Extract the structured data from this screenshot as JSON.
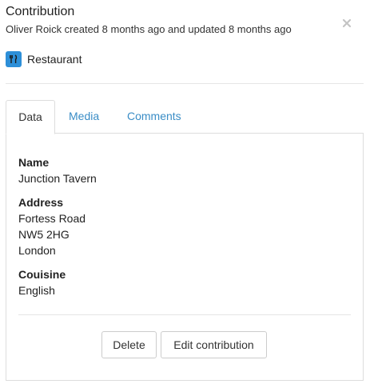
{
  "header": {
    "title": "Contribution",
    "meta": "Oliver Roick created 8 months ago and updated 8 months ago",
    "close_icon": "close-icon"
  },
  "category": {
    "icon": "restaurant-cutlery-icon",
    "icon_color": "#2d8fd8",
    "label": "Restaurant"
  },
  "tabs": [
    {
      "label": "Data",
      "active": true
    },
    {
      "label": "Media",
      "active": false
    },
    {
      "label": "Comments",
      "active": false
    }
  ],
  "fields": {
    "name": {
      "label": "Name",
      "values": [
        "Junction Tavern"
      ]
    },
    "address": {
      "label": "Address",
      "values": [
        "Fortess Road",
        "NW5 2HG",
        "London"
      ]
    },
    "cuisine": {
      "label": "Couisine",
      "values": [
        "English"
      ]
    }
  },
  "actions": {
    "delete_label": "Delete",
    "edit_label": "Edit contribution"
  },
  "colors": {
    "link": "#3a8dc6",
    "border": "#dddddd"
  }
}
